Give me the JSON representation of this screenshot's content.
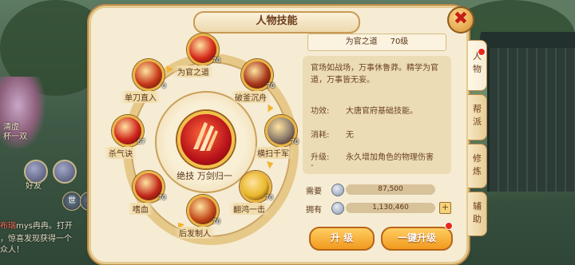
{
  "window": {
    "title": "人物技能",
    "close_symbol": "✖"
  },
  "tabs": [
    {
      "label_1": "人",
      "label_2": "物",
      "active": true
    },
    {
      "label_1": "帮",
      "label_2": "派",
      "active": false
    },
    {
      "label_1": "修",
      "label_2": "炼",
      "active": false
    },
    {
      "label_1": "辅",
      "label_2": "助",
      "active": false
    }
  ],
  "center_skill": {
    "name": "绝技  万剑归一",
    "icon": "sword-burst-icon"
  },
  "skills": [
    {
      "name": "为官之道",
      "level": "70",
      "icon": "official-helmet-icon",
      "color": "#d62b1a"
    },
    {
      "name": "破釜沉舟",
      "level": "70",
      "icon": "axe-strike-icon",
      "color": "#a8361a"
    },
    {
      "name": "横扫千军",
      "level": "70",
      "icon": "sweep-blade-icon",
      "color": "#8a7a6a"
    },
    {
      "name": "翻鸿一击",
      "level": "70",
      "icon": "feather-strike-icon",
      "color": "#e9b82a"
    },
    {
      "name": "后发制人",
      "level": "70",
      "icon": "counter-attack-icon",
      "color": "#c44a1a"
    },
    {
      "name": "嗜血",
      "level": "70",
      "icon": "blood-blade-icon",
      "color": "#c2291a"
    },
    {
      "name": "杀气诀",
      "level": "67",
      "icon": "killing-aura-icon",
      "color": "#d0231a"
    },
    {
      "name": "单刀直入",
      "level": "0",
      "icon": "single-blade-icon",
      "color": "#c83a1a"
    }
  ],
  "detail": {
    "skill_name": "为官之道",
    "skill_level": "70级",
    "description": "官场如战场，万事休鲁莽。精学为官道，万事皆无妄。",
    "effect_label": "功效:",
    "effect_value": "大唐官府基础技能。",
    "cost_label": "消耗:",
    "cost_value": "无",
    "upgrade_label": "升级:",
    "upgrade_value": "永久增加角色的物理伤害",
    "upgrade_suffix": "-"
  },
  "resources": {
    "need_label": "需要",
    "need_value": "87,500",
    "have_label": "拥有",
    "have_value": "1,130,460",
    "plus": "+"
  },
  "buttons": {
    "upgrade": "升 级",
    "one_key_upgrade": "一键升级"
  },
  "background": {
    "side_text_1": "清虚",
    "side_text_2": "杯一双",
    "friend_label": "好友",
    "chat_name": "布瑞",
    "chat_1": "mys冉冉。打开",
    "chat_2": "，惊喜发现获得一个",
    "chat_3": "众人！",
    "button_1": "世",
    "button_2": "🎤"
  }
}
